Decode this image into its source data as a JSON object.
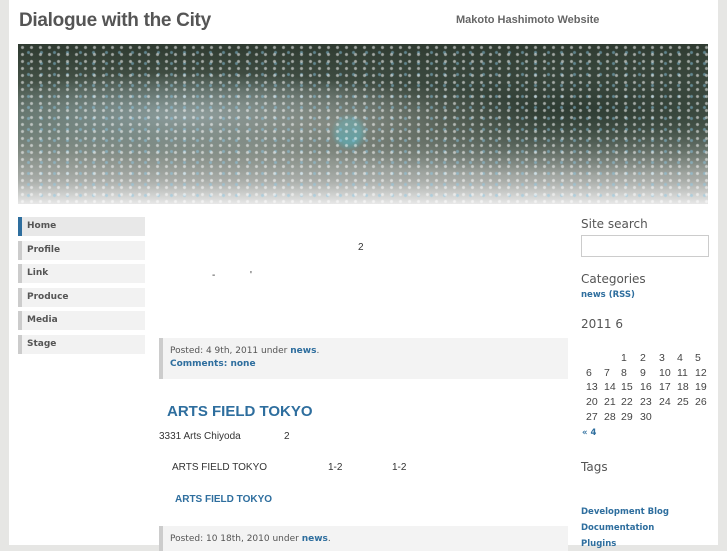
{
  "header": {
    "title": "Dialogue with the City",
    "tagline": "Makoto Hashimoto Website"
  },
  "nav": [
    "Home",
    "Profile",
    "Link",
    "Produce",
    "Media",
    "Stage"
  ],
  "post1": {
    "text1": "2",
    "text2": "-",
    "text3": "'",
    "meta_posted": "Posted: 4   9th, 2011 under",
    "meta_cat": "news",
    "meta_comments": "Comments: none"
  },
  "post2": {
    "title": "ARTS FIELD TOKYO",
    "line1a": "3331 Arts Chiyoda",
    "line1b": "2",
    "line2a": "ARTS FIELD TOKYO",
    "line2b": "1-2",
    "line2c": "1-2",
    "link": "ARTS FIELD TOKYO",
    "meta_posted": "Posted: 10   18th, 2010 under",
    "meta_cat": "news"
  },
  "sidebar": {
    "search_label": "Site search",
    "search_value": "",
    "categories_label": "Categories",
    "category": "news",
    "rss": "RSS",
    "calendar_title": "2011 6",
    "calendar_weeks": [
      [
        "",
        "",
        "1",
        "2",
        "3",
        "4",
        "5"
      ],
      [
        "6",
        "7",
        "8",
        "9",
        "10",
        "11",
        "12"
      ],
      [
        "13",
        "14",
        "15",
        "16",
        "17",
        "18",
        "19"
      ],
      [
        "20",
        "21",
        "22",
        "23",
        "24",
        "25",
        "26"
      ],
      [
        "27",
        "28",
        "29",
        "30",
        "",
        "",
        ""
      ]
    ],
    "calendar_prev": "« 4",
    "tags_label": "Tags",
    "tags": [
      "Development Blog",
      "Documentation",
      "Plugins"
    ]
  }
}
